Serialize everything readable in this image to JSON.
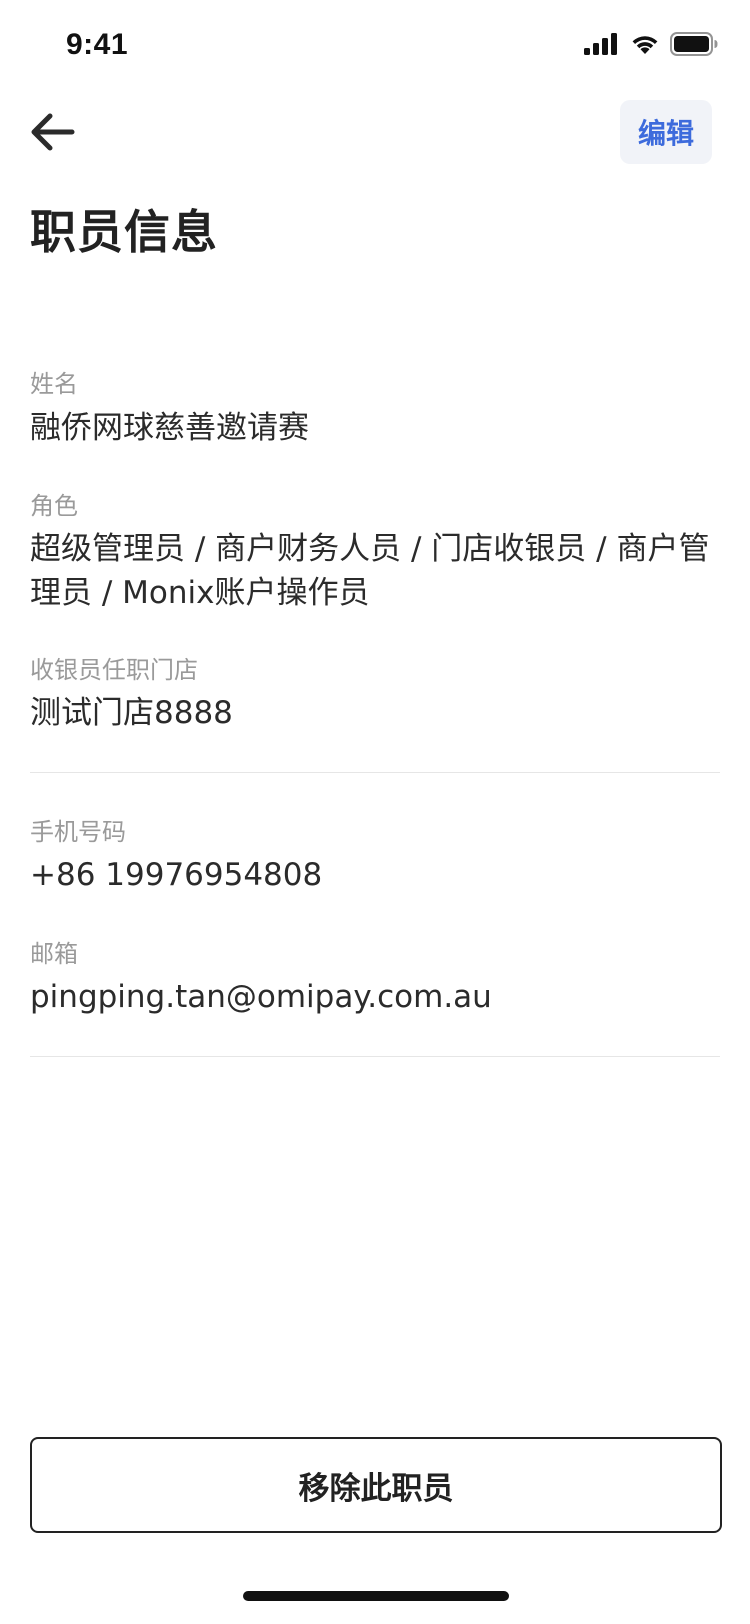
{
  "status_bar": {
    "time": "9:41",
    "icons": [
      "signal-icon",
      "wifi-icon",
      "battery-icon"
    ]
  },
  "nav": {
    "back_icon": "arrow-left-icon",
    "edit_label": "编辑"
  },
  "page": {
    "title": "职员信息"
  },
  "fields": {
    "name": {
      "label": "姓名",
      "value": "融侨网球慈善邀请赛"
    },
    "role": {
      "label": "角色",
      "value": "超级管理员 / 商户财务人员 / 门店收银员 / 商户管理员 / Monix账户操作员"
    },
    "store": {
      "label": "收银员任职门店",
      "value": "测试门店8888"
    },
    "phone": {
      "label": "手机号码",
      "value": "+86 19976954808"
    },
    "email": {
      "label": "邮箱",
      "value": "pingping.tan@omipay.com.au"
    }
  },
  "actions": {
    "remove_label": "移除此职员"
  },
  "colors": {
    "accent": "#3d6bdc",
    "edit_bg": "#f1f3f8",
    "label": "#9a9a9a",
    "text": "#2b2b2b",
    "divider": "#e6e6e6"
  }
}
